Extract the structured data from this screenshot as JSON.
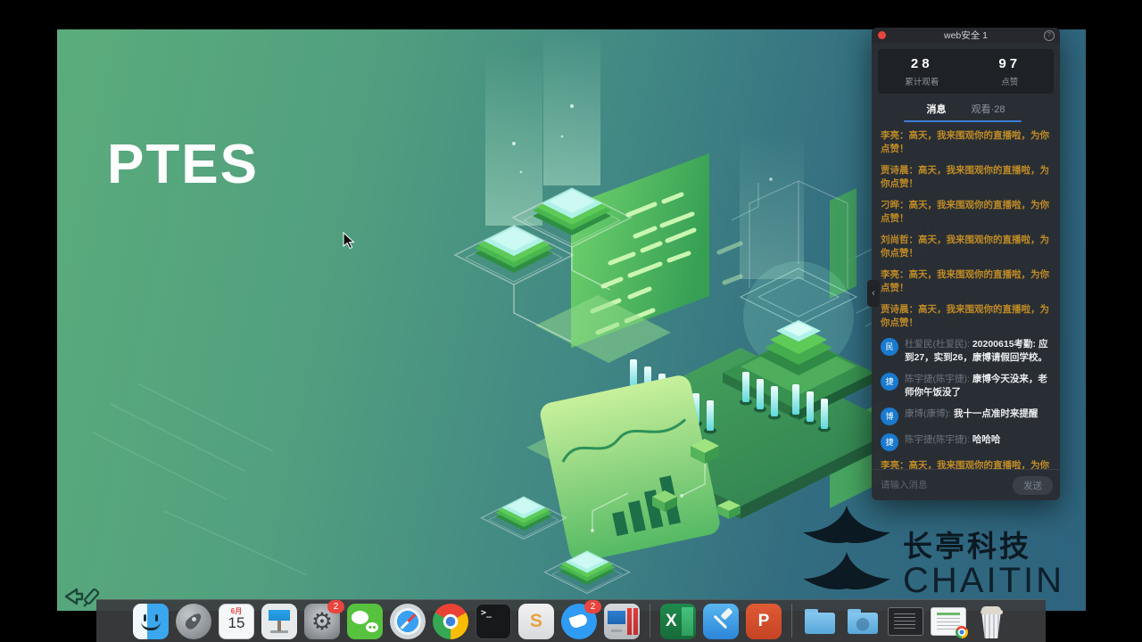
{
  "slide": {
    "title": "PTES"
  },
  "watermark": {
    "cn": "长亭科技",
    "en": "CHAITIN"
  },
  "live_panel": {
    "title": "web安全 1",
    "help_glyph": "?",
    "collapse_glyph": "‹",
    "stats": [
      {
        "value": "28",
        "label": "累计观看"
      },
      {
        "value": "97",
        "label": "点赞"
      }
    ],
    "tabs": [
      {
        "label": "消息",
        "active": true
      },
      {
        "label": "观看·28",
        "active": false
      }
    ],
    "messages": [
      {
        "kind": "system",
        "text": "李亮：高天，我来围观你的直播啦，为你点赞！"
      },
      {
        "kind": "system",
        "text": "贾诗晨：高天，我来围观你的直播啦，为你点赞！"
      },
      {
        "kind": "system",
        "text": "刁晔：高天，我来围观你的直播啦，为你点赞！"
      },
      {
        "kind": "system",
        "text": "刘尚哲：高天，我来围观你的直播啦，为你点赞！"
      },
      {
        "kind": "system",
        "text": "李亮：高天，我来围观你的直播啦，为你点赞！"
      },
      {
        "kind": "system",
        "text": "贾诗晨：高天，我来围观你的直播啦，为你点赞！"
      },
      {
        "kind": "user",
        "avatar": "民",
        "name": "杜爱民(杜爱民):",
        "text": "20200615考勤: 应到27，实到26，康博请假回学校。"
      },
      {
        "kind": "user",
        "avatar": "捷",
        "name": "陈宇捷(陈宇捷):",
        "text": "康博今天没来，老师你午饭没了"
      },
      {
        "kind": "user",
        "avatar": "博",
        "name": "康博(康博):",
        "text": "我十一点准时来提醒"
      },
      {
        "kind": "user",
        "avatar": "捷",
        "name": "陈宇捷(陈宇捷):",
        "text": "哈哈哈"
      },
      {
        "kind": "system",
        "text": "李亮：高天，我来围观你的直播啦，为你点赞！"
      }
    ],
    "input_placeholder": "请输入消息",
    "send_label": "发送"
  },
  "dock": {
    "items": [
      {
        "id": "finder",
        "name": "Finder",
        "running": true
      },
      {
        "id": "launchpad",
        "name": "Launchpad"
      },
      {
        "id": "calendar",
        "name": "Calendar",
        "month": "6月",
        "day": "15"
      },
      {
        "id": "keynote",
        "name": "Keynote",
        "running": true
      },
      {
        "id": "settings",
        "name": "System Preferences",
        "glyph": "⚙",
        "badge": "2"
      },
      {
        "id": "wechat",
        "name": "WeChat",
        "running": true
      },
      {
        "id": "safari",
        "name": "Safari",
        "running": true
      },
      {
        "id": "chrome",
        "name": "Chrome",
        "running": true
      },
      {
        "id": "terminal",
        "name": "Terminal",
        "glyph": ">_",
        "running": true
      },
      {
        "id": "sublime",
        "name": "Sublime Text",
        "glyph": "S",
        "running": true
      },
      {
        "id": "dingtalk",
        "name": "DingTalk",
        "badge": "2",
        "running": true
      },
      {
        "id": "parallels",
        "name": "Parallels Desktop",
        "running": true
      },
      {
        "type": "separator"
      },
      {
        "id": "excel",
        "name": "Excel",
        "glyph": "X",
        "running": true
      },
      {
        "id": "xcode",
        "name": "Xcode",
        "running": true
      },
      {
        "id": "powerpoint",
        "name": "PowerPoint",
        "glyph": "P",
        "running": true
      },
      {
        "type": "separator"
      },
      {
        "id": "folder-apps",
        "name": "Applications Folder"
      },
      {
        "id": "folder-downloads",
        "name": "Downloads Folder"
      },
      {
        "id": "min-terminal",
        "name": "Minimized Terminal Window",
        "thumb": true
      },
      {
        "id": "min-document",
        "name": "Minimized Document Window",
        "thumb": true
      },
      {
        "id": "trash",
        "name": "Trash"
      }
    ]
  },
  "colors": {
    "accent_blue": "#3d7fd6",
    "system_message_orange": "#bd8a26",
    "avatar_blue": "#1a7ad0",
    "badge_red": "#e8453f",
    "slide_green": "#5bac7c",
    "slide_teal": "#2e647e"
  }
}
